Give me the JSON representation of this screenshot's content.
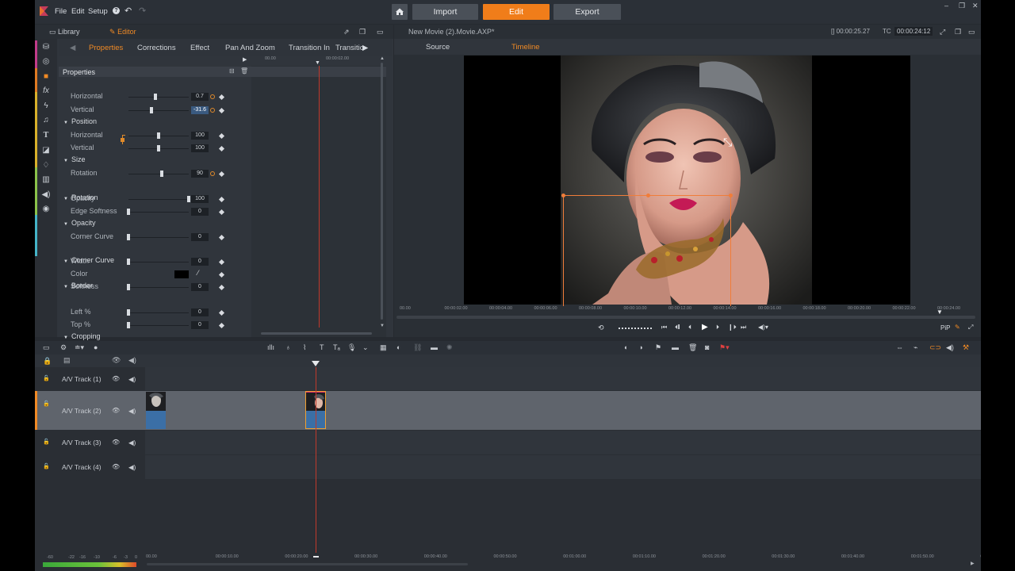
{
  "menu": {
    "file": "File",
    "edit": "Edit",
    "setup": "Setup",
    "help": "?"
  },
  "nav": {
    "import": "Import",
    "edit": "Edit",
    "export": "Export"
  },
  "panel": {
    "library": "Library",
    "editor": "Editor"
  },
  "movie_title": "New Movie (2).Movie.AXP*",
  "timecodes": {
    "duration": "[] 00:00:25.27",
    "tc_label": "TC",
    "tc_value": "00:00:24:12"
  },
  "tabs": [
    "Properties",
    "Corrections",
    "Effect",
    "Pan And Zoom",
    "Transition In",
    "Transitic"
  ],
  "mini_ruler": [
    "00.00",
    "00:00:02.00"
  ],
  "properties_title": "Properties",
  "sections": [
    {
      "title": "Position",
      "rows": [
        {
          "label": "Horizontal",
          "value": "0.7",
          "level": 0.45
        },
        {
          "label": "Vertical",
          "value": "-31.6",
          "level": 0.38
        }
      ]
    },
    {
      "title": "Size",
      "rows": [
        {
          "label": "Horizontal",
          "value": "100",
          "level": 0.5
        },
        {
          "label": "Vertical",
          "value": "100",
          "level": 0.5
        }
      ]
    },
    {
      "title": "Rotation",
      "rows": [
        {
          "label": "Rotation",
          "value": "90",
          "level": 0.55
        }
      ]
    },
    {
      "title": "Opacity",
      "rows": [
        {
          "label": "Opacity",
          "value": "100",
          "level": 1.0
        },
        {
          "label": "Edge Softness",
          "value": "0",
          "level": 0.0
        }
      ]
    },
    {
      "title": "Corner Curve",
      "rows": [
        {
          "label": "Corner Curve",
          "value": "0",
          "level": 0.0
        }
      ]
    },
    {
      "title": "Border",
      "rows": [
        {
          "label": "Width",
          "value": "0",
          "level": 0.0
        },
        {
          "label": "Color",
          "value": "",
          "level": -1
        },
        {
          "label": "Softness",
          "value": "0",
          "level": 0.0
        }
      ]
    },
    {
      "title": "Cropping",
      "rows": [
        {
          "label": "Left %",
          "value": "0",
          "level": 0.0
        },
        {
          "label": "Top %",
          "value": "0",
          "level": 0.0
        }
      ]
    }
  ],
  "preview_tabs": {
    "source": "Source",
    "timeline": "Timeline"
  },
  "preview_ruler": [
    "00.00",
    "00:00:02.00",
    "00:00:04.00",
    "00:00:06.00",
    "00:00:08.00",
    "00:00:10.00",
    "00:00:12.00",
    "00:00:14.00",
    "00:00:16.00",
    "00:00:18.00",
    "00:00:20.00",
    "00:00:22.00",
    "00:00:24.00",
    "00:00"
  ],
  "pip_label": "PiP",
  "tracks": [
    "A/V Track (1)",
    "A/V Track (2)",
    "A/V Track (3)",
    "A/V Track (4)"
  ],
  "timeline_ruler": [
    "00.00",
    "00:00:10.00",
    "00:00:20.00",
    "00:00:30.00",
    "00:00:40.00",
    "00:00:50.00",
    "00:01:00.00",
    "00:01:10.00",
    "00:01:20.00",
    "00:01:30.00",
    "00:01:40.00",
    "00:01:50.00",
    "00:02"
  ],
  "meter_scale": [
    "-60",
    "-22",
    "-16",
    "-10",
    "-6",
    "-3",
    "0"
  ],
  "colors": {
    "accent": "#f07d1a",
    "bg": "#262a30",
    "selection": "#f07d3a"
  }
}
